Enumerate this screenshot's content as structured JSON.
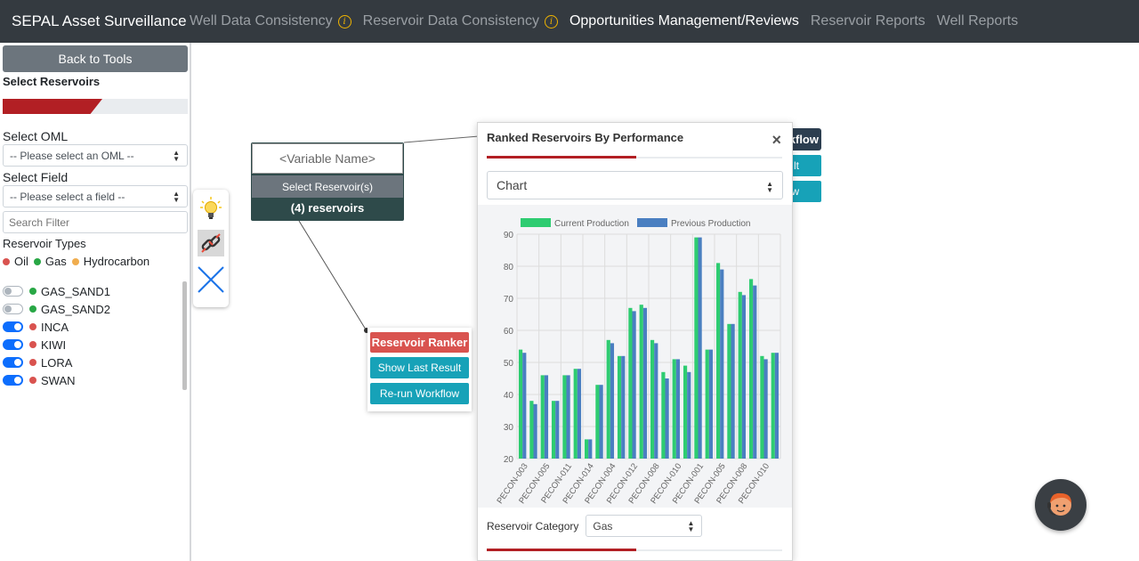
{
  "navbar": {
    "brand": "SEPAL Asset Surveillance",
    "items": [
      {
        "label": "Well Data Consistency",
        "info": true,
        "active": false
      },
      {
        "label": "Reservoir Data Consistency",
        "info": true,
        "active": false
      },
      {
        "label": "Opportunities Management/Reviews",
        "info": false,
        "active": true
      },
      {
        "label": "Reservoir Reports",
        "info": false,
        "active": false
      },
      {
        "label": "Well Reports",
        "info": false,
        "active": false
      }
    ]
  },
  "sidebar": {
    "back_label": "Back to Tools",
    "select_reservoirs": "Select Reservoirs",
    "oml_label": "Select OML",
    "oml_placeholder": "-- Please select an OML --",
    "field_label": "Select Field",
    "field_placeholder": "-- Please select a field --",
    "search_placeholder": "Search Filter",
    "types_label": "Reservoir Types",
    "types": [
      {
        "label": "Oil",
        "color": "#d9534f"
      },
      {
        "label": "Gas",
        "color": "#28a745"
      },
      {
        "label": "Hydrocarbon",
        "color": "#f0ad4e"
      }
    ],
    "reservoirs": [
      {
        "name": "GAS_SAND1",
        "on": false,
        "color": "#28a745"
      },
      {
        "name": "GAS_SAND2",
        "on": false,
        "color": "#28a745"
      },
      {
        "name": "INCA",
        "on": true,
        "color": "#d9534f"
      },
      {
        "name": "KIWI",
        "on": true,
        "color": "#d9534f"
      },
      {
        "name": "LORA",
        "on": true,
        "color": "#d9534f"
      },
      {
        "name": "SWAN",
        "on": true,
        "color": "#d9534f"
      }
    ]
  },
  "toolbox": {
    "icons": [
      "lightbulb-icon",
      "link-icon",
      "close-icon"
    ]
  },
  "variable_node": {
    "name": "<Variable Name>",
    "select_label": "Select Reservoir(s)",
    "count": "(4) reservoirs"
  },
  "ranker_node": {
    "title": "Reservoir Ranker",
    "show_last": "Show Last Result",
    "rerun": "Re-run Workflow"
  },
  "back_node": {
    "title_fragment": "kflow",
    "btn1_fragment": "lt",
    "btn2_fragment": "w"
  },
  "popover": {
    "title": "Ranked Reservoirs By Performance",
    "close": "×",
    "view_select": "Chart",
    "category_label": "Reservoir Category",
    "category_value": "Gas"
  },
  "chart_data": {
    "type": "bar",
    "ylim": [
      20,
      90
    ],
    "yticks": [
      20,
      30,
      40,
      50,
      60,
      70,
      80,
      90
    ],
    "grid": true,
    "legend_position": "top",
    "series": [
      {
        "name": "Current Production",
        "color": "#2ecc71",
        "values": [
          54,
          38,
          46,
          38,
          46,
          48,
          26,
          43,
          57,
          52,
          67,
          68,
          57,
          47,
          51,
          49,
          89,
          54,
          81,
          62,
          72,
          76,
          52,
          53
        ]
      },
      {
        "name": "Previous Production",
        "color": "#4a7fc1",
        "values": [
          53,
          37,
          46,
          38,
          46,
          48,
          26,
          43,
          56,
          52,
          66,
          67,
          56,
          45,
          51,
          47,
          89,
          54,
          79,
          62,
          71,
          74,
          51,
          53
        ]
      }
    ],
    "category_labels": [
      "PECON-003",
      "PECON-005",
      "PECON-011",
      "PECON-014",
      "PECON-004",
      "PECON-012",
      "PECON-008",
      "PECON-010",
      "PECON-001",
      "PECON-005",
      "PECON-008",
      "PECON-010"
    ]
  }
}
